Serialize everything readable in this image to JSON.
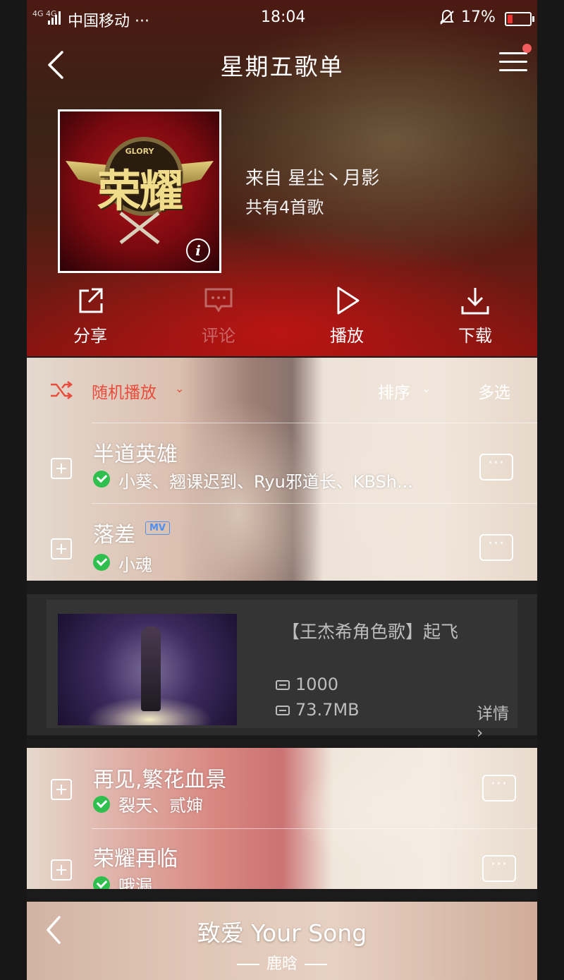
{
  "status_bar": {
    "network": "4G 4G",
    "carrier": "中国移动 ···",
    "time": "18:04",
    "battery": "17%"
  },
  "header": {
    "title": "星期五歌单",
    "back_icon": "chevron-left-icon",
    "menu_icon": "hamburger-menu-icon"
  },
  "playlist": {
    "cover_text": "荣耀",
    "cover_subtext": "GLORY",
    "from": "来自  星尘丶月影",
    "count": "共有4首歌"
  },
  "actions": [
    {
      "label": "分享",
      "icon": "share-icon"
    },
    {
      "label": "评论",
      "icon": "comment-icon"
    },
    {
      "label": "播放",
      "icon": "play-icon"
    },
    {
      "label": "下载",
      "icon": "download-icon"
    }
  ],
  "toolbar": {
    "shuffle": "随机播放",
    "sort": "排序",
    "multi_select": "多选"
  },
  "songs": [
    {
      "title": "半道英雄",
      "artist": "小葵、翘课迟到、Ryu邪道长、KBSh...",
      "mv": ""
    },
    {
      "title": "落差",
      "artist": "小魂",
      "mv": "MV"
    },
    {
      "title": "再见,繁花血景",
      "artist": "裂天、贰婶",
      "mv": ""
    },
    {
      "title": "荣耀再临",
      "artist": "哦漏",
      "mv": ""
    }
  ],
  "more_label": "···",
  "mv_card": {
    "title": "【王杰希角色歌】起飞",
    "plays": "1000",
    "size": "73.7MB",
    "detail": "详情 ›"
  },
  "now_playing": {
    "title": "致爱 Your Song",
    "artist": "鹿晗"
  },
  "colors": {
    "accent": "#e74c3c",
    "check": "#2fbf4f",
    "mv_badge": "#4f8ff0",
    "notify_dot": "#f25c5c"
  }
}
